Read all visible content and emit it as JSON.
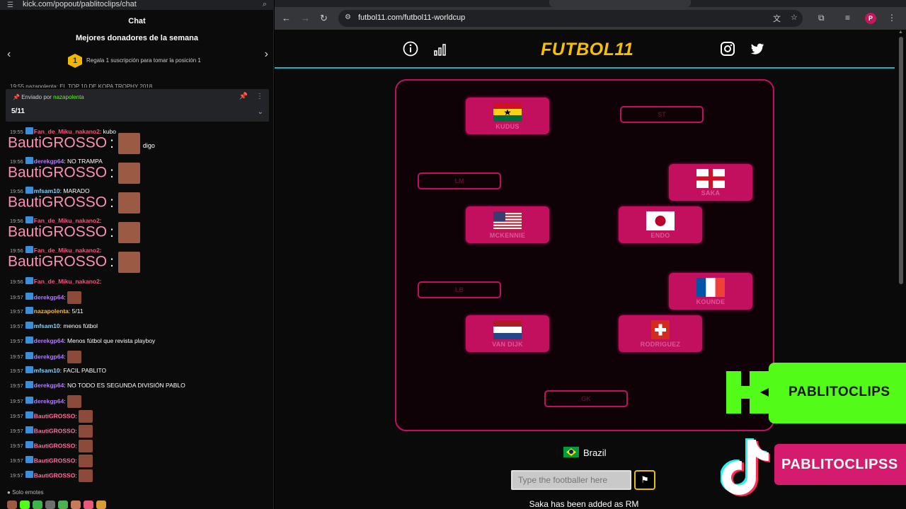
{
  "chat": {
    "url": "kick.com/popout/pablitoclips/chat",
    "title": "Chat",
    "donors_title": "Mejores donadores de la semana",
    "donors_rank": "1",
    "donors_sub": "Regala 1 suscripción para tomar la posición 1",
    "scrolled_text": "19:55 nazapolenta: EL TOP 10 DE KOPA TROPHY 2018",
    "pinned": {
      "prefix": "Enviado por",
      "user": "nazapolenta",
      "message": "5/11"
    },
    "big_name": "BautiGROSSO",
    "lines": [
      {
        "time": "19:55",
        "user": "Fan_de_Miku_nakano2",
        "color": "#ff4f7b",
        "text": ": kubo"
      },
      {
        "time": "19:56",
        "user": "derekgp64",
        "color": "#b37cff",
        "text": ": NO TRAMPA"
      },
      {
        "time": "19:56",
        "user": "mfsam10",
        "color": "#7fd3ff",
        "text": ": MARADO"
      },
      {
        "time": "19:56",
        "user": "Fan_de_Miku_nakano2",
        "color": "#ff4f7b",
        "text": ":"
      },
      {
        "time": "19:56",
        "user": "Fan_de_Miku_nakano2",
        "color": "#ff4f7b",
        "text": ":"
      },
      {
        "time": "19:56",
        "user": "Fan_de_Miku_nakano2",
        "color": "#ff4f7b",
        "text": ":"
      },
      {
        "time": "19:57",
        "user": "derekgp64",
        "color": "#b37cff",
        "text": ":"
      },
      {
        "time": "19:57",
        "user": "nazapolenta",
        "color": "#f7b733",
        "text": ": 5/11"
      },
      {
        "time": "19:57",
        "user": "mfsam10",
        "color": "#7fd3ff",
        "text": ": menos fútbol"
      },
      {
        "time": "19:57",
        "user": "derekgp64",
        "color": "#b37cff",
        "text": ": Menos fútbol que revista playboy"
      },
      {
        "time": "19:57",
        "user": "derekgp64",
        "color": "#b37cff",
        "text": ":"
      },
      {
        "time": "19:57",
        "user": "mfsam10",
        "color": "#7fd3ff",
        "text": ": FACIL PABLITO"
      },
      {
        "time": "19:57",
        "user": "derekgp64",
        "color": "#b37cff",
        "text": ": NO TODO ES SEGUNDA DIVISIÓN PABLO"
      },
      {
        "time": "19:57",
        "user": "derekgp64",
        "color": "#b37cff",
        "text": ":"
      },
      {
        "time": "19:57",
        "user": "BautiGROSSO",
        "color": "#ff6f9a",
        "text": ":"
      },
      {
        "time": "19:57",
        "user": "BautiGROSSO",
        "color": "#ff6f9a",
        "text": ":"
      },
      {
        "time": "19:57",
        "user": "BautiGROSSO",
        "color": "#ff6f9a",
        "text": ":"
      },
      {
        "time": "19:57",
        "user": "BautiGROSSO",
        "color": "#ff6f9a",
        "text": ":"
      },
      {
        "time": "19:57",
        "user": "BautiGROSSO",
        "color": "#ff6f9a",
        "text": ":"
      }
    ],
    "line_extra": "digo",
    "solo_label": "Solo emotes"
  },
  "browser": {
    "url": "futbol11.com/futbol11-worldcup",
    "profile_initial": "P"
  },
  "site": {
    "logo": "FUTBOL11",
    "info_icon": "info-icon",
    "stats_icon": "bar-chart-icon",
    "instagram_icon": "instagram-icon",
    "twitter_icon": "twitter-icon"
  },
  "pitch": {
    "cards": [
      {
        "id": "kudus",
        "name": "KUDUS",
        "flag": "ghana"
      },
      {
        "id": "saka",
        "name": "SAKA",
        "flag": "england"
      },
      {
        "id": "mckennie",
        "name": "MCKENNIE",
        "flag": "usa"
      },
      {
        "id": "endo",
        "name": "ENDO",
        "flag": "japan"
      },
      {
        "id": "kounde",
        "name": "KOUNDE",
        "flag": "france"
      },
      {
        "id": "vandijk",
        "name": "VAN DIJK",
        "flag": "netherlands"
      },
      {
        "id": "rodriguez",
        "name": "RODRIGUEZ",
        "flag": "switzerland"
      }
    ],
    "slots": {
      "st": "ST",
      "lm": "LM",
      "lb": "LB",
      "gk": "GK"
    }
  },
  "game": {
    "country": "Brazil",
    "input_placeholder": "Type the footballer here",
    "status": "Saka has been added as RM"
  },
  "overlays": {
    "kick_name": "PABLITOCLIPS",
    "kick_color": "#53fc18",
    "tiktok_name": "PABLITOCLIPSS",
    "tiktok_color": "#d41b6e"
  },
  "colors": {
    "accent_pink": "#c2105f",
    "logo_yellow": "#f6c000",
    "header_line": "#1fb4c0"
  }
}
